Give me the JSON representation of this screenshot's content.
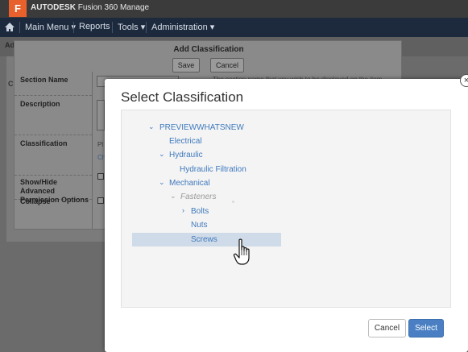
{
  "app": {
    "logo_letter": "F",
    "brand_bold": "AUTODESK",
    "brand_rest": " Fusion 360 Manage"
  },
  "nav": {
    "items": [
      {
        "label": "Main Menu ▾"
      },
      {
        "label": "Reports"
      },
      {
        "label": "Tools ▾"
      },
      {
        "label": "Administration ▾"
      }
    ]
  },
  "background_page": {
    "frag_top": "Ad",
    "frag_left": "C"
  },
  "add_dialog": {
    "title": "Add Classification",
    "save_label": "Save",
    "cancel_label": "Cancel",
    "fields": [
      {
        "label": "Section Name"
      },
      {
        "label": "Description"
      },
      {
        "label": "Classification"
      },
      {
        "label": "Show/Hide Advanced Permission Options"
      },
      {
        "label": "Collapse"
      }
    ],
    "classification_frag_1": "Pl",
    "classification_frag_2": "Ch",
    "section_hint": "The section name that you wish to be displayed on the item"
  },
  "select_dialog": {
    "title": "Select Classification",
    "close_label": "×",
    "tree": [
      {
        "label": "PREVIEWWHATSNEW",
        "expanded": true
      },
      {
        "label": "Electrical"
      },
      {
        "label": "Hydraulic",
        "expanded": true
      },
      {
        "label": "Hydraulic Filtration"
      },
      {
        "label": "Mechanical",
        "expanded": true
      },
      {
        "label": "Fasteners",
        "expanded": true,
        "muted": true
      },
      {
        "label": "Bolts",
        "collapsed": true
      },
      {
        "label": "Nuts"
      },
      {
        "label": "Screws",
        "selected": true
      }
    ],
    "cancel_label": "Cancel",
    "select_label": "Select"
  },
  "colors": {
    "accent": "#4a80c3",
    "link": "#3f79bd",
    "nav_bg": "#1d2a3d",
    "selection": "#cfdbe8"
  }
}
